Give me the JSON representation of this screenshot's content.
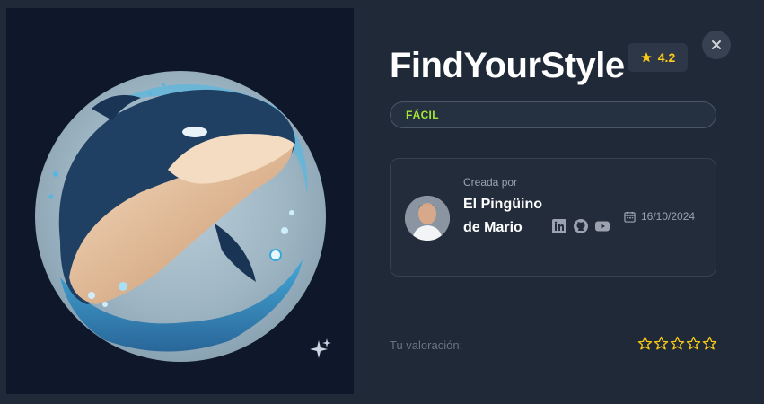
{
  "project": {
    "title": "FindYourStyle",
    "rating": "4.2",
    "difficulty": "FÁCIL"
  },
  "author": {
    "created_by_label": "Creada por",
    "name": "El Pingüino de Mario",
    "date": "16/10/2024",
    "socials": [
      "linkedin-icon",
      "github-icon",
      "youtube-icon"
    ]
  },
  "user_rating": {
    "label": "Tu valoración:",
    "stars_total": 5,
    "stars_filled": 0
  },
  "colors": {
    "background": "#1f2937",
    "accent_star": "#facc15",
    "difficulty_green": "#a3e635"
  },
  "icons": {
    "close": "close-icon",
    "sparkle": "sparkle-icon",
    "calendar": "calendar-icon",
    "star": "star-icon"
  }
}
